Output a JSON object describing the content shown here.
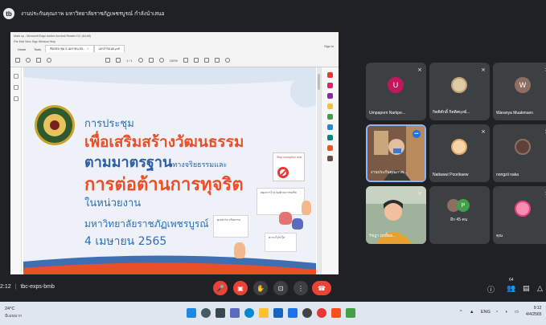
{
  "topbar": {
    "icon_label": "tb",
    "title": "งานประกันคุณภาพ มหาวิทยาลัยราชภัฏเพชรบูรณ์ กำลังนำเสนอ"
  },
  "pdf_viewer": {
    "menu_row_1": "Mark up - Microsoft Edge Adobe Acrobat Reader DC (64-bit)",
    "menu_row_2": "File  Edit  View  Sign  Window  Help",
    "tabs": [
      "Home",
      "Tools",
      "ห้องประชุม 4 เมษายน 65...",
      "เอกสารแนบ.pdf"
    ],
    "sign_in": "Sign In",
    "zoom": "100%",
    "page_indicator": "1 / 1"
  },
  "slide": {
    "line1": "การประชุม",
    "line2": "เพื่อเสริมสร้างวัฒนธรรม",
    "line3_main": "ตามมาตรฐาน",
    "line3_small": "ทางจริยธรรมและ",
    "line4": "การต่อต้านการทุจริต",
    "line5": "ในหน่วยงาน",
    "line6": "มหาวิทยาลัยราชภัฏเพชรบูรณ์",
    "line7": "4 เมษายน 2565",
    "sign_text": "Stop corruption now",
    "card1_text": "หยุดการโกง ต่อต้านการทุจริต",
    "card2_text": "คุณธรรม จริยธรรม",
    "card3_text": "ความโปร่งใส"
  },
  "participants": [
    {
      "name": "Umpaporn Narkpe...",
      "initial": "U",
      "avatar_color": "#c2185b",
      "type": "avatar"
    },
    {
      "name": "กิตติศักดิ์ กิตติศฤงฆ์...",
      "initial": "",
      "avatar_color": "#e0c9a6",
      "type": "photo"
    },
    {
      "name": "Waranya Muakmuen",
      "initial": "W",
      "avatar_color": "#8d6e63",
      "type": "avatar"
    },
    {
      "name": "งานประกันคุณภาพ...",
      "initial": "",
      "avatar_color": "#6d4c41",
      "type": "video"
    },
    {
      "name": "Nattawut Poorikaew",
      "initial": "",
      "avatar_color": "#f6d5a8",
      "type": "photo"
    },
    {
      "name": "nongzii naka",
      "initial": "",
      "avatar_color": "#5d4037",
      "type": "photo"
    },
    {
      "name": "รัชฎา ฤทธิ์ผล...",
      "initial": "",
      "avatar_color": "#f0c0a0",
      "type": "video"
    },
    {
      "name": "อีก 45 คน",
      "initial": "P",
      "avatar_color": "#43a047",
      "type": "group"
    },
    {
      "name": "คุณ",
      "initial": "",
      "avatar_color": "#f48fb1",
      "type": "photo"
    }
  ],
  "controls": {
    "time": "2:12",
    "meeting_code": "tbc-exps-bmb",
    "people_count": "64",
    "icons": [
      "mic-off-icon",
      "camera-off-icon",
      "raise-hand-icon",
      "present-icon",
      "more-icon",
      "end-call-icon"
    ],
    "colors": {
      "danger": "#ea4335",
      "neutral": "#3c4043",
      "accent": "#8ab4f8"
    }
  },
  "taskbar": {
    "weather_temp": "24°C",
    "weather_desc": "มีเมฆมาก",
    "tray_lang": "ENG",
    "clock_time": "9:12",
    "clock_date": "4/4/2565"
  }
}
